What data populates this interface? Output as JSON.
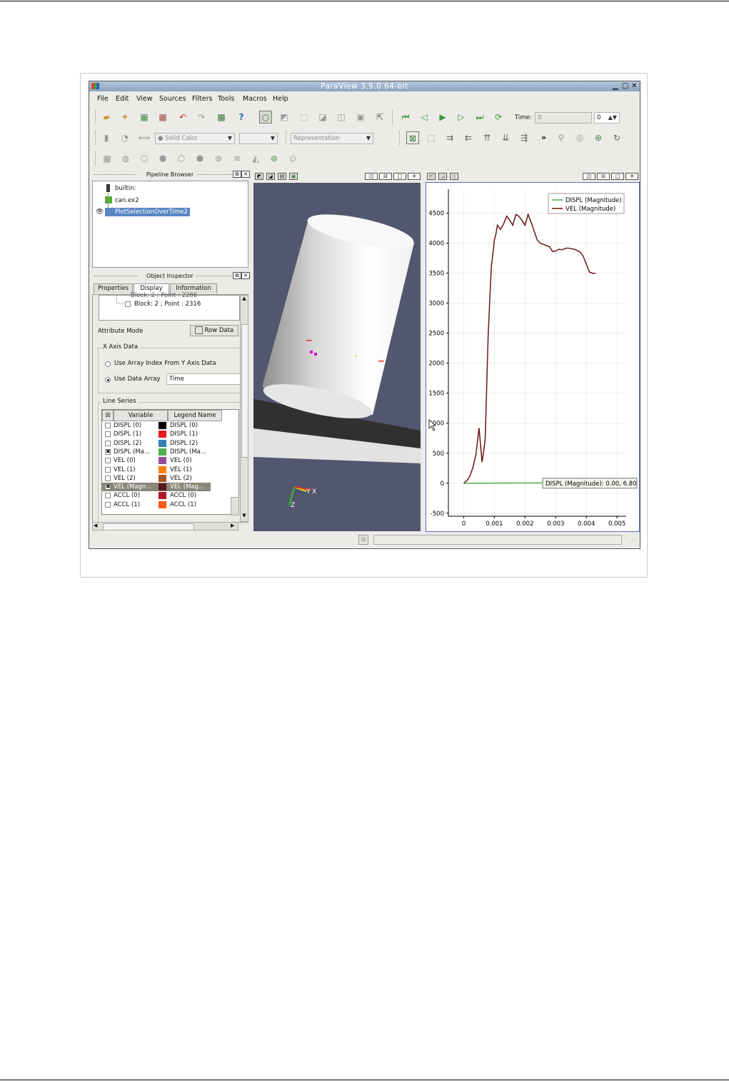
{
  "window": {
    "title": "ParaView 3.9.0 64-bit"
  },
  "menu": [
    "File",
    "Edit",
    "View",
    "Sources",
    "Filters",
    "Tools",
    "Macros",
    "Help"
  ],
  "toolbar": {
    "time_label": "Time:",
    "time_value": "0",
    "time_index": "0",
    "coloring": "Solid Color",
    "representation": "Representation",
    "more_glyph": "»"
  },
  "pipeline": {
    "title": "Pipeline Browser",
    "items": [
      "builtin:",
      "can.ex2",
      "PlotSelectionOverTime2"
    ]
  },
  "inspector": {
    "title": "Object Inspector",
    "tabs": [
      "Properties",
      "Display",
      "Information"
    ],
    "active_tab": "Display",
    "tree_items": [
      "Block: 2 ; Point : 2286",
      "Block: 2 ; Point : 2316"
    ],
    "attribute_mode_label": "Attribute Mode",
    "attribute_mode_value": "Row Data",
    "x_axis_group": "X Axis Data",
    "radio_index": "Use Array Index From Y Axis Data",
    "radio_array": "Use Data Array",
    "array_value": "Time",
    "line_series_group": "Line Series",
    "col_variable": "Variable",
    "col_legend": "Legend Name",
    "series": [
      {
        "variable": "DISPL (0)",
        "legend": "DISPL (0)",
        "color": "#000000",
        "checked": false
      },
      {
        "variable": "DISPL (1)",
        "legend": "DISPL (1)",
        "color": "#e21a1c",
        "checked": false
      },
      {
        "variable": "DISPL (2)",
        "legend": "DISPL (2)",
        "color": "#377eb8",
        "checked": false
      },
      {
        "variable": "DISPL (Ma...",
        "legend": "DISPL (Ma...",
        "color": "#4daf4a",
        "checked": true
      },
      {
        "variable": "VEL (0)",
        "legend": "VEL (0)",
        "color": "#984ea3",
        "checked": false
      },
      {
        "variable": "VEL (1)",
        "legend": "VEL (1)",
        "color": "#ff7f00",
        "checked": false
      },
      {
        "variable": "VEL (2)",
        "legend": "VEL (2)",
        "color": "#a65628",
        "checked": false
      },
      {
        "variable": "VEL (Magn...",
        "legend": "VEL (Mag...",
        "color": "#5a1a1a",
        "checked": true
      },
      {
        "variable": "ACCL (0)",
        "legend": "ACCL (0)",
        "color": "#b2182b",
        "checked": false
      },
      {
        "variable": "ACCL (1)",
        "legend": "ACCL (1)",
        "color": "#ff5a14",
        "checked": false
      }
    ]
  },
  "viewport3d": {
    "axes": {
      "y": "Y",
      "x": "X",
      "z": "Z"
    }
  },
  "chart_data": {
    "type": "line",
    "title": "",
    "xlabel": "",
    "ylabel": "",
    "xlim": [
      -0.0005,
      0.0053
    ],
    "ylim": [
      -550,
      4900
    ],
    "xticks": [
      "0",
      "0.001",
      "0.002",
      "0.003",
      "0.004",
      "0.005"
    ],
    "yticks": [
      "-500",
      "0",
      "500",
      "1000",
      "1500",
      "2000",
      "2500",
      "3000",
      "3500",
      "4000",
      "4500"
    ],
    "grid": true,
    "legend_position": "top-right",
    "series": [
      {
        "name": "DISPL (Magnitude)",
        "color": "#4daf4a",
        "x": [
          0,
          0.0043
        ],
        "y": [
          0,
          6.8
        ]
      },
      {
        "name": "VEL (Magnitude)",
        "color": "#6b1414",
        "x": [
          0,
          0.0001,
          0.0002,
          0.0003,
          0.0004,
          0.0005,
          0.0006,
          0.0007,
          0.0008,
          0.0009,
          0.001,
          0.00105,
          0.0011,
          0.0012,
          0.0013,
          0.0014,
          0.0015,
          0.0016,
          0.0017,
          0.0018,
          0.0019,
          0.002,
          0.0021,
          0.0022,
          0.0023,
          0.0024,
          0.0025,
          0.0026,
          0.0027,
          0.0028,
          0.0029,
          0.003,
          0.0031,
          0.0032,
          0.0033,
          0.0034,
          0.0035,
          0.0036,
          0.0037,
          0.0038,
          0.0039,
          0.004,
          0.0041,
          0.0042,
          0.0043
        ],
        "y": [
          0,
          40,
          120,
          260,
          480,
          920,
          350,
          720,
          2500,
          3600,
          4050,
          4150,
          4300,
          4230,
          4320,
          4450,
          4380,
          4300,
          4480,
          4450,
          4380,
          4300,
          4480,
          4350,
          4200,
          4050,
          4000,
          3980,
          3960,
          3940,
          3860,
          3870,
          3900,
          3890,
          3910,
          3920,
          3910,
          3900,
          3880,
          3850,
          3780,
          3650,
          3520,
          3500,
          3500
        ]
      }
    ],
    "tooltip": "DISPL (Magnitude): 0.00, 6.80"
  }
}
